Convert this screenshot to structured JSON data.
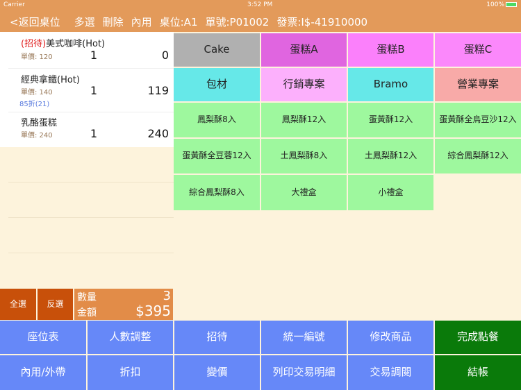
{
  "status": {
    "carrier": "Carrier",
    "time": "3:52 PM",
    "battery": "100%"
  },
  "nav": {
    "back": "<返回桌位",
    "multi": "多選",
    "delete": "刪除",
    "dine": "內用",
    "table": "桌位:A1",
    "order": "單號:P01002",
    "invoice": "發票:I$-41910000"
  },
  "items": [
    {
      "tag": "(招待)",
      "name": "美式咖啡(Hot)",
      "price": "單價: 120",
      "qty": "1",
      "amount": "0",
      "discount": ""
    },
    {
      "tag": "",
      "name": "經典拿鐵(Hot)",
      "price": "單價: 140",
      "qty": "1",
      "amount": "119",
      "discount": "85折(21)"
    },
    {
      "tag": "",
      "name": "乳酪蛋糕",
      "price": "單價: 240",
      "qty": "1",
      "amount": "240",
      "discount": ""
    }
  ],
  "categories": [
    {
      "label": "Cake",
      "color": "#b0b0b0"
    },
    {
      "label": "蛋糕A",
      "color": "#e065e0"
    },
    {
      "label": "蛋糕B",
      "color": "#fb80fb"
    },
    {
      "label": "蛋糕C",
      "color": "#fb88fb"
    },
    {
      "label": "包材",
      "color": "#66e8e8"
    },
    {
      "label": "行銷專案",
      "color": "#fcb0fc"
    },
    {
      "label": "Bramo",
      "color": "#66e8e8"
    },
    {
      "label": "營業專案",
      "color": "#f8aaa8"
    }
  ],
  "products": [
    "鳳梨酥8入",
    "鳳梨酥12入",
    "蛋黃酥12入",
    "蛋黃酥全烏豆沙12入",
    "蛋黃酥全豆蓉12入",
    "土鳳梨酥8入",
    "土鳳梨酥12入",
    "綜合鳳梨酥12入",
    "綜合鳳梨酥8入",
    "大禮盒",
    "小禮盒"
  ],
  "select": {
    "all": "全選",
    "invert": "反選"
  },
  "summary": {
    "qty_label": "數量",
    "qty": "3",
    "amount_label": "金額",
    "amount": "$395"
  },
  "actions": [
    "座位表",
    "人數調整",
    "招待",
    "統一編號",
    "修改商品",
    "完成點餐",
    "內用/外帶",
    "折扣",
    "變價",
    "列印交易明細",
    "交易調閱",
    "結帳"
  ]
}
